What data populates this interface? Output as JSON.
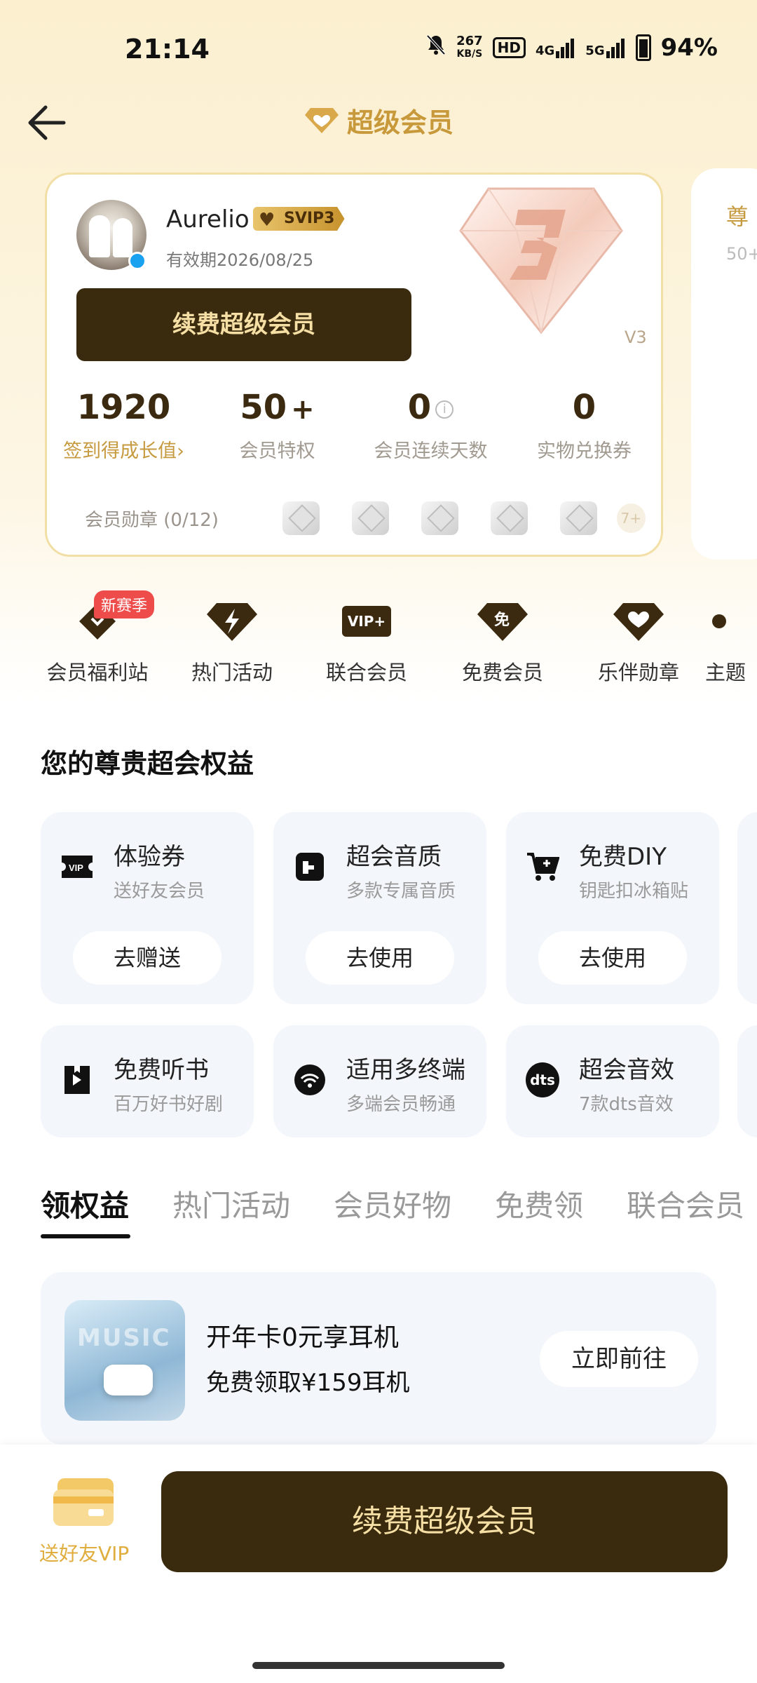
{
  "status_bar": {
    "time": "21:14",
    "network_speed_value": "267",
    "network_speed_unit": "KB/S",
    "hd_badge": "HD",
    "signal_1": "4G",
    "signal_2": "5G",
    "battery": "94%"
  },
  "header": {
    "title": "超级会员",
    "back_icon": "arrow-left-icon",
    "title_icon": "diamond-heart-icon"
  },
  "member_card": {
    "user_name": "Aurelio",
    "level_badge": "SVIP3",
    "expiry": "有效期2026/08/25",
    "renew_button": "续费超级会员",
    "level_tag": "V3",
    "stats": [
      {
        "value": "1920",
        "label": "签到得成长值",
        "suffix": "›"
      },
      {
        "value": "50",
        "plus": "+",
        "label": "会员特权"
      },
      {
        "value": "0",
        "label": "会员连续天数",
        "info": "i"
      },
      {
        "value": "0",
        "label": "实物兑换券"
      }
    ],
    "medals_label": "会员勋章 (0/12)",
    "medals_more": "7+"
  },
  "peek_card": {
    "title": "尊",
    "sub": "50+"
  },
  "quick_links": [
    {
      "label": "会员福利站",
      "tag": "新赛季",
      "icon": "heart-diamond-icon"
    },
    {
      "label": "热门活动",
      "icon": "lightning-diamond-icon"
    },
    {
      "label": "联合会员",
      "icon": "vip-plus-icon",
      "icon_text": "VIP+"
    },
    {
      "label": "免费会员",
      "icon": "free-diamond-icon",
      "icon_text": "免"
    },
    {
      "label": "乐伴勋章",
      "icon": "heart-badge-icon"
    },
    {
      "label": "主题",
      "icon": "theme-icon"
    }
  ],
  "rights_section": {
    "title": "您的尊贵超会权益",
    "cards": [
      {
        "title": "体验券",
        "sub": "送好友会员",
        "button": "去赠送",
        "icon": "vip-ticket-icon"
      },
      {
        "title": "超会音质",
        "sub": "多款专属音质",
        "button": "去使用",
        "icon": "sound-quality-icon"
      },
      {
        "title": "免费DIY",
        "sub": "钥匙扣冰箱贴",
        "button": "去使用",
        "icon": "cart-icon"
      },
      {
        "title": "免费听书",
        "sub": "百万好书好剧",
        "icon": "audiobook-icon"
      },
      {
        "title": "适用多终端",
        "sub": "多端会员畅通",
        "icon": "wifi-icon"
      },
      {
        "title": "超会音效",
        "sub": "7款dts音效",
        "icon": "dts-icon",
        "icon_text": "dts"
      }
    ]
  },
  "tabs": [
    {
      "label": "领权益",
      "active": true
    },
    {
      "label": "热门活动"
    },
    {
      "label": "会员好物"
    },
    {
      "label": "免费领"
    },
    {
      "label": "联合会员"
    }
  ],
  "promo": {
    "title": "开年卡0元享耳机",
    "sub": "免费领取¥159耳机",
    "button": "立即前往"
  },
  "bottom_bar": {
    "gift_label": "送好友VIP",
    "renew_button": "续费超级会员"
  },
  "colors": {
    "gold": "#c69a3f",
    "dark_brown": "#3a2a0e",
    "button_text_gold": "#f6dfa4",
    "card_bg": "#f3f6fb"
  }
}
